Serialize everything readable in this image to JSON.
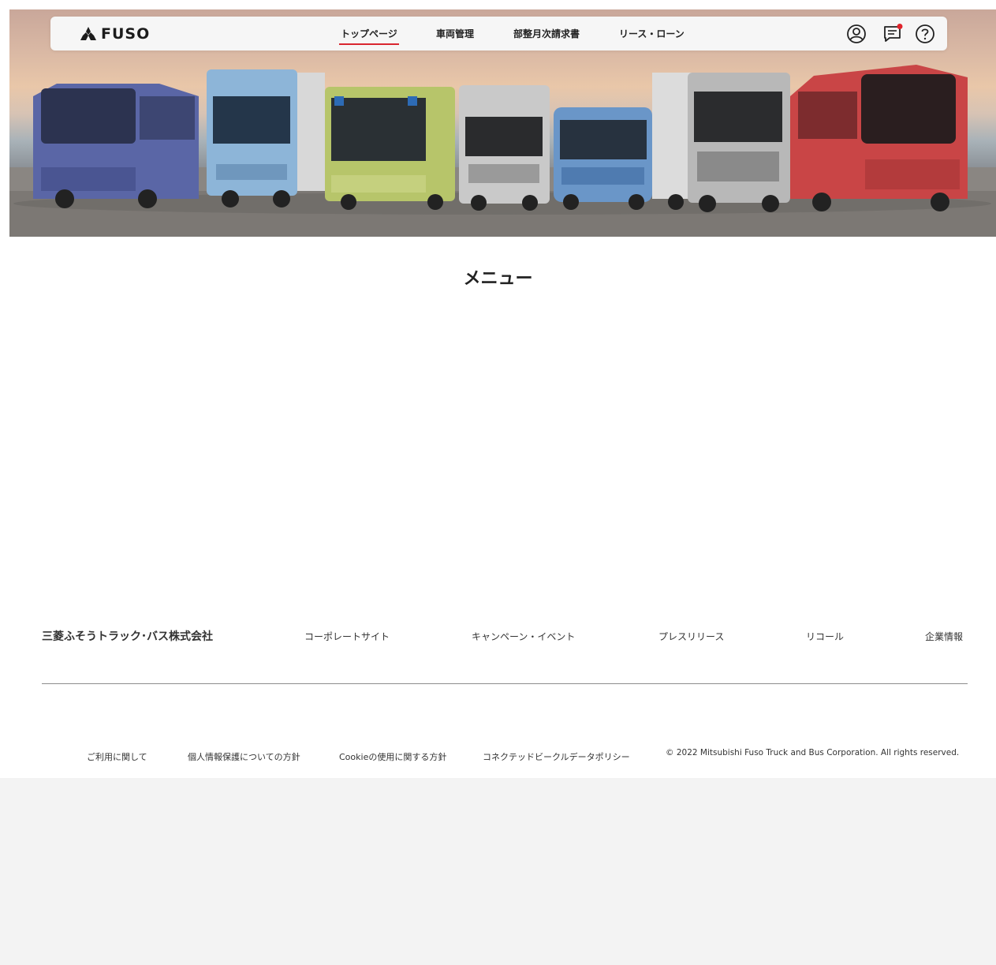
{
  "header": {
    "logo_text": "FUSO",
    "nav": [
      {
        "label": "トップページ",
        "active": true
      },
      {
        "label": "車両管理"
      },
      {
        "label": "部整月次請求書"
      },
      {
        "label": "リース・ローン"
      }
    ],
    "icons": [
      "account-icon",
      "message-icon",
      "help-icon"
    ],
    "accent_color": "#d9262f"
  },
  "main": {
    "title": "メニュー"
  },
  "footer": {
    "company": "三菱ふそうトラック･バス株式会社",
    "links": [
      "コーポレートサイト",
      "キャンペーン・イベント",
      "プレスリリース",
      "リコール",
      "企業情報"
    ],
    "bottom_links": [
      "ご利用に関して",
      "個人情報保護についての方針",
      "Cookieの使用に関する方針",
      "コネクテッドビークルデータポリシー"
    ],
    "copyright": "© 2022 Mitsubishi Fuso Truck and Bus Corporation. All rights reserved."
  }
}
